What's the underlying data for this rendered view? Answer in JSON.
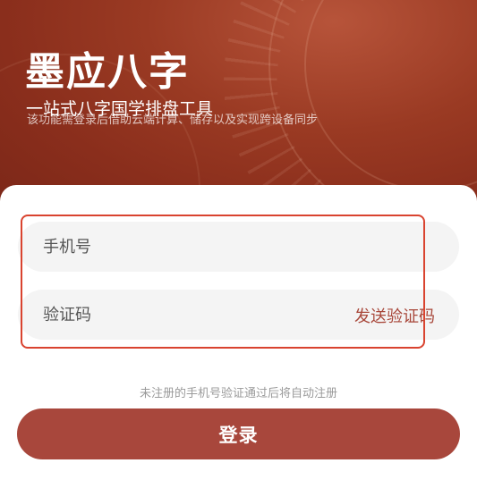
{
  "header": {
    "title": "墨应八字",
    "subtitle": "一站式八字国学排盘工具",
    "description": "该功能需登录后借助云端计算、储存以及实现跨设备同步"
  },
  "form": {
    "phone_placeholder": "手机号",
    "code_placeholder": "验证码",
    "send_code_label": "发送验证码"
  },
  "hint": "未注册的手机号验证通过后将自动注册",
  "login_label": "登录",
  "colors": {
    "hero_background": "#9a3a23",
    "accent": "#a8473c",
    "highlight_border": "#d9432f",
    "field_background": "#f4f4f4"
  }
}
